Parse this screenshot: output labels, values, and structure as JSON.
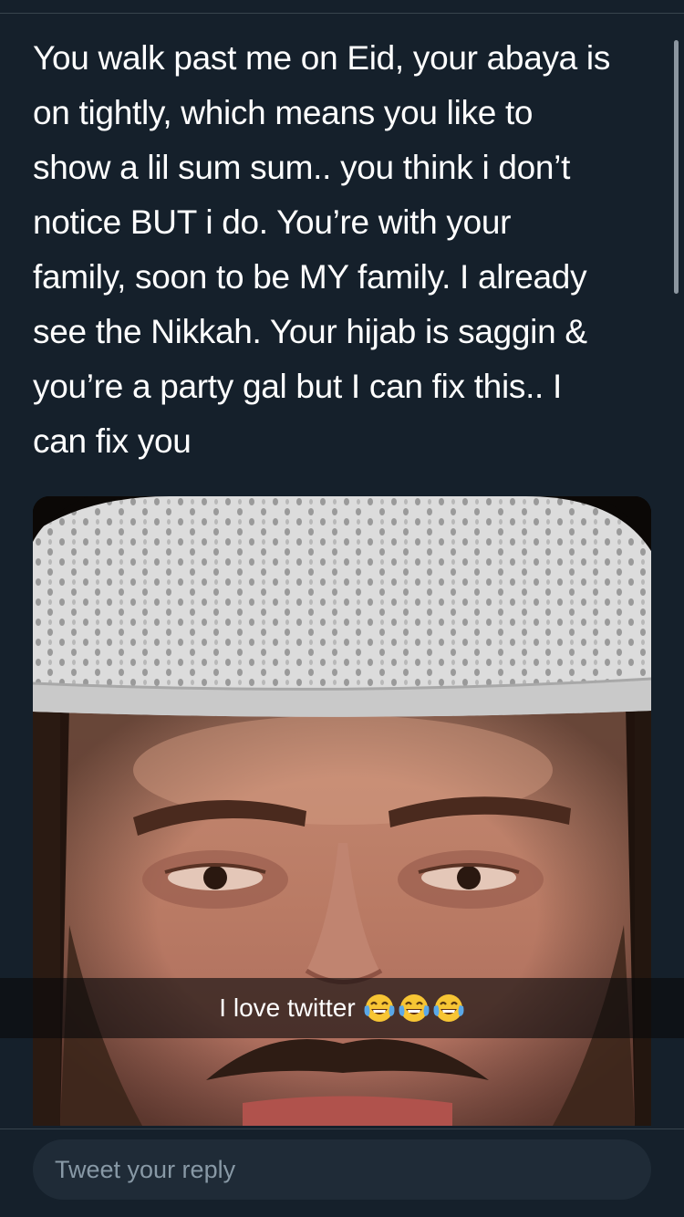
{
  "tweet": {
    "text_lines": [
      "You walk past me on Eid, your abaya is",
      "on tightly, which means you like to",
      "show a lil sum sum.. you think i don’t",
      "notice BUT i do. You’re with your",
      "family, soon to be MY family. I already",
      "see the Nikkah. Your hijab is saggin &",
      "you’re a party gal but I can fix this.. I",
      "can fix you"
    ]
  },
  "media": {
    "caption": "I love twitter",
    "caption_emoji": [
      "face-with-tears-of-joy",
      "face-with-tears-of-joy",
      "face-with-tears-of-joy"
    ]
  },
  "reply": {
    "placeholder": "Tweet your reply"
  },
  "colors": {
    "background": "#15202b",
    "text": "#ffffff",
    "placeholder": "#8899a6",
    "divider": "#38444d"
  }
}
